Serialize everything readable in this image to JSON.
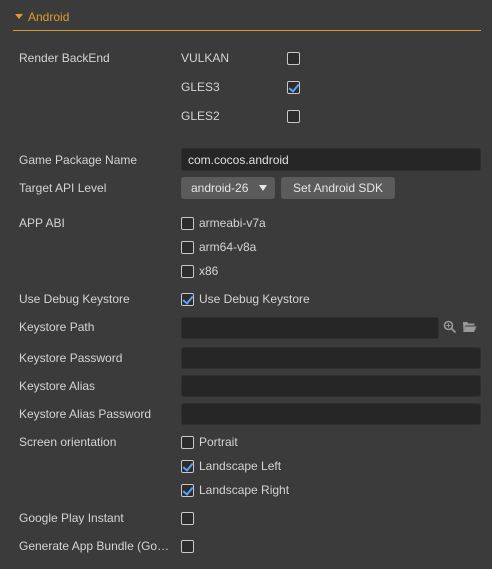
{
  "section": {
    "title": "Android"
  },
  "render_backend": {
    "label": "Render BackEnd",
    "options": [
      {
        "label": "VULKAN",
        "checked": false
      },
      {
        "label": "GLES3",
        "checked": true
      },
      {
        "label": "GLES2",
        "checked": false
      }
    ]
  },
  "game_package_name": {
    "label": "Game Package Name",
    "value": "com.cocos.android"
  },
  "target_api_level": {
    "label": "Target API Level",
    "value": "android-26",
    "button_label": "Set Android SDK"
  },
  "app_abi": {
    "label": "APP ABI",
    "options": [
      {
        "label": "armeabi-v7a",
        "checked": false
      },
      {
        "label": "arm64-v8a",
        "checked": false
      },
      {
        "label": "x86",
        "checked": false
      }
    ]
  },
  "use_debug_keystore": {
    "label": "Use Debug Keystore",
    "option_label": "Use Debug Keystore",
    "checked": true
  },
  "keystore_path": {
    "label": "Keystore Path",
    "value": "",
    "icons": [
      "search-icon",
      "folder-icon"
    ]
  },
  "keystore_password": {
    "label": "Keystore Password",
    "value": ""
  },
  "keystore_alias": {
    "label": "Keystore Alias",
    "value": ""
  },
  "keystore_alias_password": {
    "label": "Keystore Alias Password",
    "value": ""
  },
  "screen_orientation": {
    "label": "Screen orientation",
    "options": [
      {
        "label": "Portrait",
        "checked": false
      },
      {
        "label": "Landscape Left",
        "checked": true
      },
      {
        "label": "Landscape Right",
        "checked": true
      }
    ]
  },
  "google_play_instant": {
    "label": "Google Play Instant",
    "checked": false
  },
  "generate_app_bundle": {
    "label": "Generate App Bundle (Go…",
    "checked": false
  },
  "colors": {
    "accent": "#e39a2d",
    "check": "#5aa0ff",
    "background": "#3b3b3b"
  }
}
